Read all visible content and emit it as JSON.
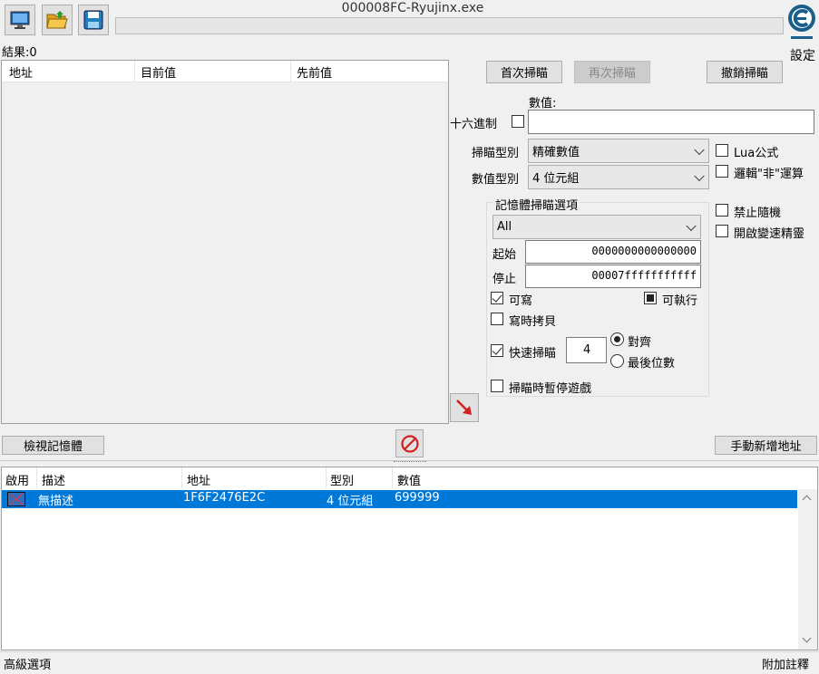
{
  "window": {
    "title": "000008FC-Ryujinx.exe"
  },
  "toolbar": {
    "open_process_icon": "monitor-icon",
    "open_file_icon": "folder-open-icon",
    "save_icon": "floppy-disk-icon"
  },
  "settings": {
    "label": "設定",
    "logo_icon": "cheat-engine-logo"
  },
  "results": {
    "label": "結果:0"
  },
  "results_table": {
    "columns": [
      "地址",
      "目前值",
      "先前值"
    ]
  },
  "scan": {
    "first_scan_label": "首次掃瞄",
    "next_scan_label": "再次掃瞄",
    "undo_scan_label": "撤銷掃瞄",
    "value_label": "數值:",
    "hex_label": "十六進制",
    "value_input": "",
    "scan_type_label": "掃瞄型別",
    "scan_type_value": "精確數值",
    "value_type_label": "數值型別",
    "value_type_value": "4 位元組",
    "lua_formula_label": "Lua公式",
    "not_logic_label": "邏輯\"非\"運算",
    "no_random_label": "禁止隨機",
    "speedhack_label": "開啟變速精靈"
  },
  "memory_options": {
    "group_label": "記憶體掃瞄選項",
    "region_value": "All",
    "start_label": "起始",
    "start_value": "0000000000000000",
    "stop_label": "停止",
    "stop_value": "00007fffffffffff",
    "writable_label": "可寫",
    "executable_label": "可執行",
    "copy_on_write_label": "寫時拷貝",
    "fast_scan_label": "快速掃瞄",
    "fast_scan_value": "4",
    "alignment_label": "對齊",
    "last_digits_label": "最後位數",
    "pause_game_label": "掃瞄時暫停遊戲"
  },
  "actions": {
    "view_memory_label": "檢視記憶體",
    "add_address_label": "手動新增地址",
    "add_to_list_icon": "red-arrow-icon",
    "clear_list_icon": "no-entry-icon"
  },
  "address_list": {
    "columns": [
      "啟用",
      "描述",
      "地址",
      "型別",
      "數值"
    ],
    "rows": [
      {
        "active": false,
        "description": "無描述",
        "address": "1F6F2476E2C",
        "type": "4 位元組",
        "value": "699999"
      }
    ]
  },
  "status_bar": {
    "advanced_label": "高級選項",
    "comments_label": "附加註釋"
  },
  "colors": {
    "selection": "#0078d7",
    "disabled_button": "#cccccc",
    "arrow_red": "#d32020"
  }
}
